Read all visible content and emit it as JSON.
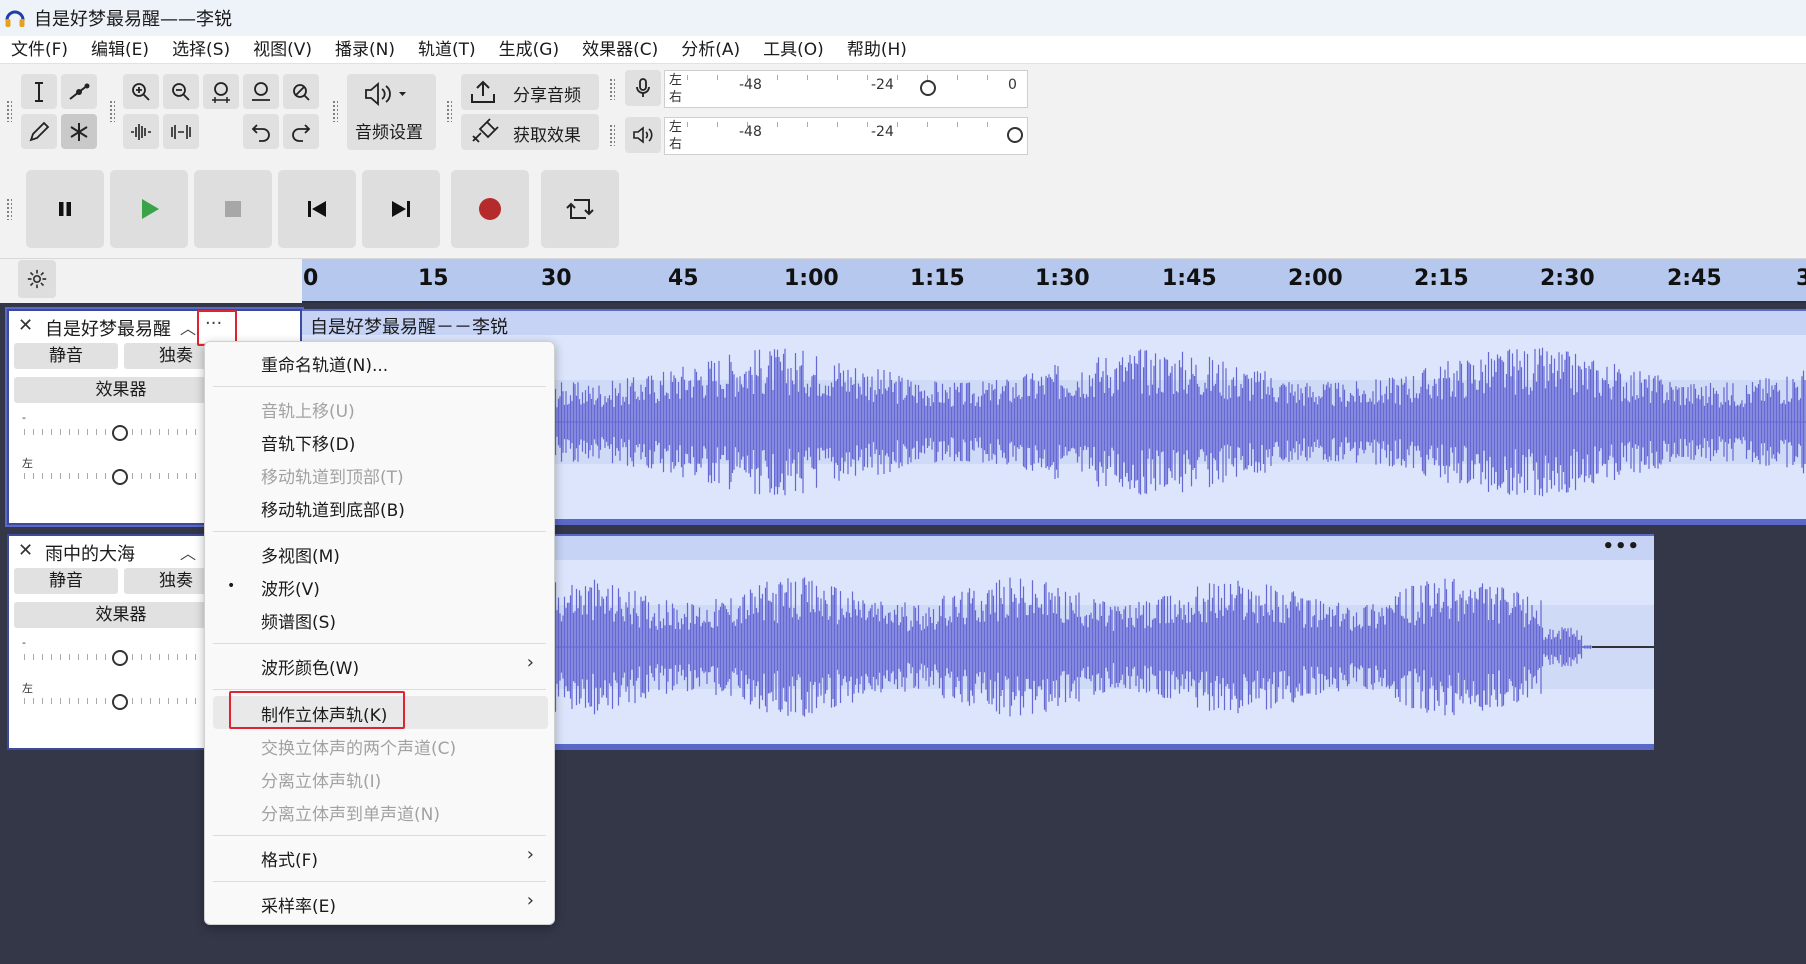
{
  "window": {
    "title": "自是好梦最易醒——李锐"
  },
  "menubar": {
    "items": [
      "文件(F)",
      "编辑(E)",
      "选择(S)",
      "视图(V)",
      "播录(N)",
      "轨道(T)",
      "生成(G)",
      "效果器(C)",
      "分析(A)",
      "工具(O)",
      "帮助(H)"
    ]
  },
  "toolbar": {
    "audio_setup_label": "音频设置",
    "share_audio_label": "分享音频",
    "get_effects_label": "获取效果",
    "record_meter": {
      "left": "左",
      "right": "右",
      "ticks": [
        "-48",
        "-24",
        "0"
      ]
    },
    "play_meter": {
      "left": "左",
      "right": "右",
      "ticks": [
        "-48",
        "-24"
      ]
    }
  },
  "ruler": {
    "ticks": [
      "0",
      "15",
      "30",
      "45",
      "1:00",
      "1:15",
      "1:30",
      "1:45",
      "2:00",
      "2:15",
      "2:30",
      "2:45",
      "3"
    ]
  },
  "tracks": [
    {
      "name": "自是好梦最易醒",
      "mute": "静音",
      "solo": "独奏",
      "effects": "效果器",
      "pan_left": "左",
      "gain_minus": "-",
      "clip_title": "自是好梦最易醒－－李锐"
    },
    {
      "name": "雨中的大海",
      "mute": "静音",
      "solo": "独奏",
      "effects": "效果器",
      "pan_left": "左",
      "gain_minus": "-",
      "clip_title": ""
    }
  ],
  "track_menu_button": "···",
  "clip_menu_button": "•••",
  "context_menu": {
    "items": [
      {
        "label": "重命名轨道(N)...",
        "disabled": false
      },
      {
        "label": "音轨上移(U)",
        "disabled": true
      },
      {
        "label": "音轨下移(D)",
        "disabled": false
      },
      {
        "label": "移动轨道到顶部(T)",
        "disabled": true
      },
      {
        "label": "移动轨道到底部(B)",
        "disabled": false
      },
      {
        "label": "多视图(M)",
        "disabled": false
      },
      {
        "label": "波形(V)",
        "disabled": false,
        "checked": true
      },
      {
        "label": "频谱图(S)",
        "disabled": false
      },
      {
        "label": "波形颜色(W)",
        "disabled": false,
        "submenu": true
      },
      {
        "label": "制作立体声轨(K)",
        "disabled": false,
        "highlighted": true
      },
      {
        "label": "交换立体声的两个声道(C)",
        "disabled": true
      },
      {
        "label": "分离立体声轨(I)",
        "disabled": true
      },
      {
        "label": "分离立体声到单声道(N)",
        "disabled": true
      },
      {
        "label": "格式(F)",
        "disabled": false,
        "submenu": true
      },
      {
        "label": "采样率(E)",
        "disabled": false,
        "submenu": true
      }
    ],
    "bullet": "•",
    "submenu_arrow": "›"
  },
  "colors": {
    "waveform": "#6567d3",
    "ruler": "#b7c8ee",
    "highlight": "#e0232e",
    "record": "#b52b2b",
    "play": "#3aa34a"
  }
}
